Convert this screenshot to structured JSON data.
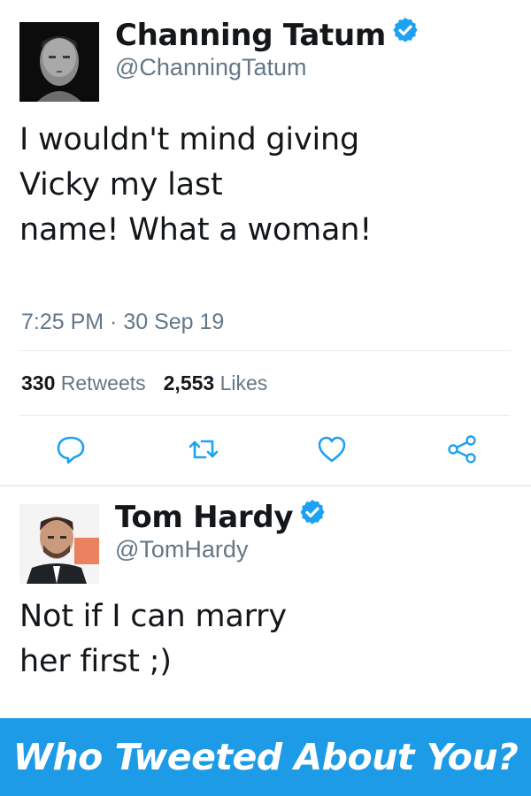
{
  "tweet1": {
    "name": "Channing Tatum",
    "handle": "@ChanningTatum",
    "text": "I wouldn't mind giving\nVicky my last\nname! What a woman!",
    "timestamp": "7:25 PM · 30 Sep 19",
    "retweets_count": "330",
    "retweets_label": "Retweets",
    "likes_count": "2,553",
    "likes_label": "Likes"
  },
  "tweet2": {
    "name": "Tom Hardy",
    "handle": "@TomHardy",
    "text": "Not if I can marry\nher first ;)"
  },
  "banner": {
    "text": "Who Tweeted About You?"
  },
  "colors": {
    "verified_blue": "#1da1f2",
    "banner_blue": "#1e9be7",
    "muted_gray": "#657786",
    "text_dark": "#14171a"
  },
  "icons": {
    "reply": "reply-icon",
    "retweet": "retweet-icon",
    "like": "heart-icon",
    "share": "share-icon",
    "verified": "verified-badge-icon"
  }
}
